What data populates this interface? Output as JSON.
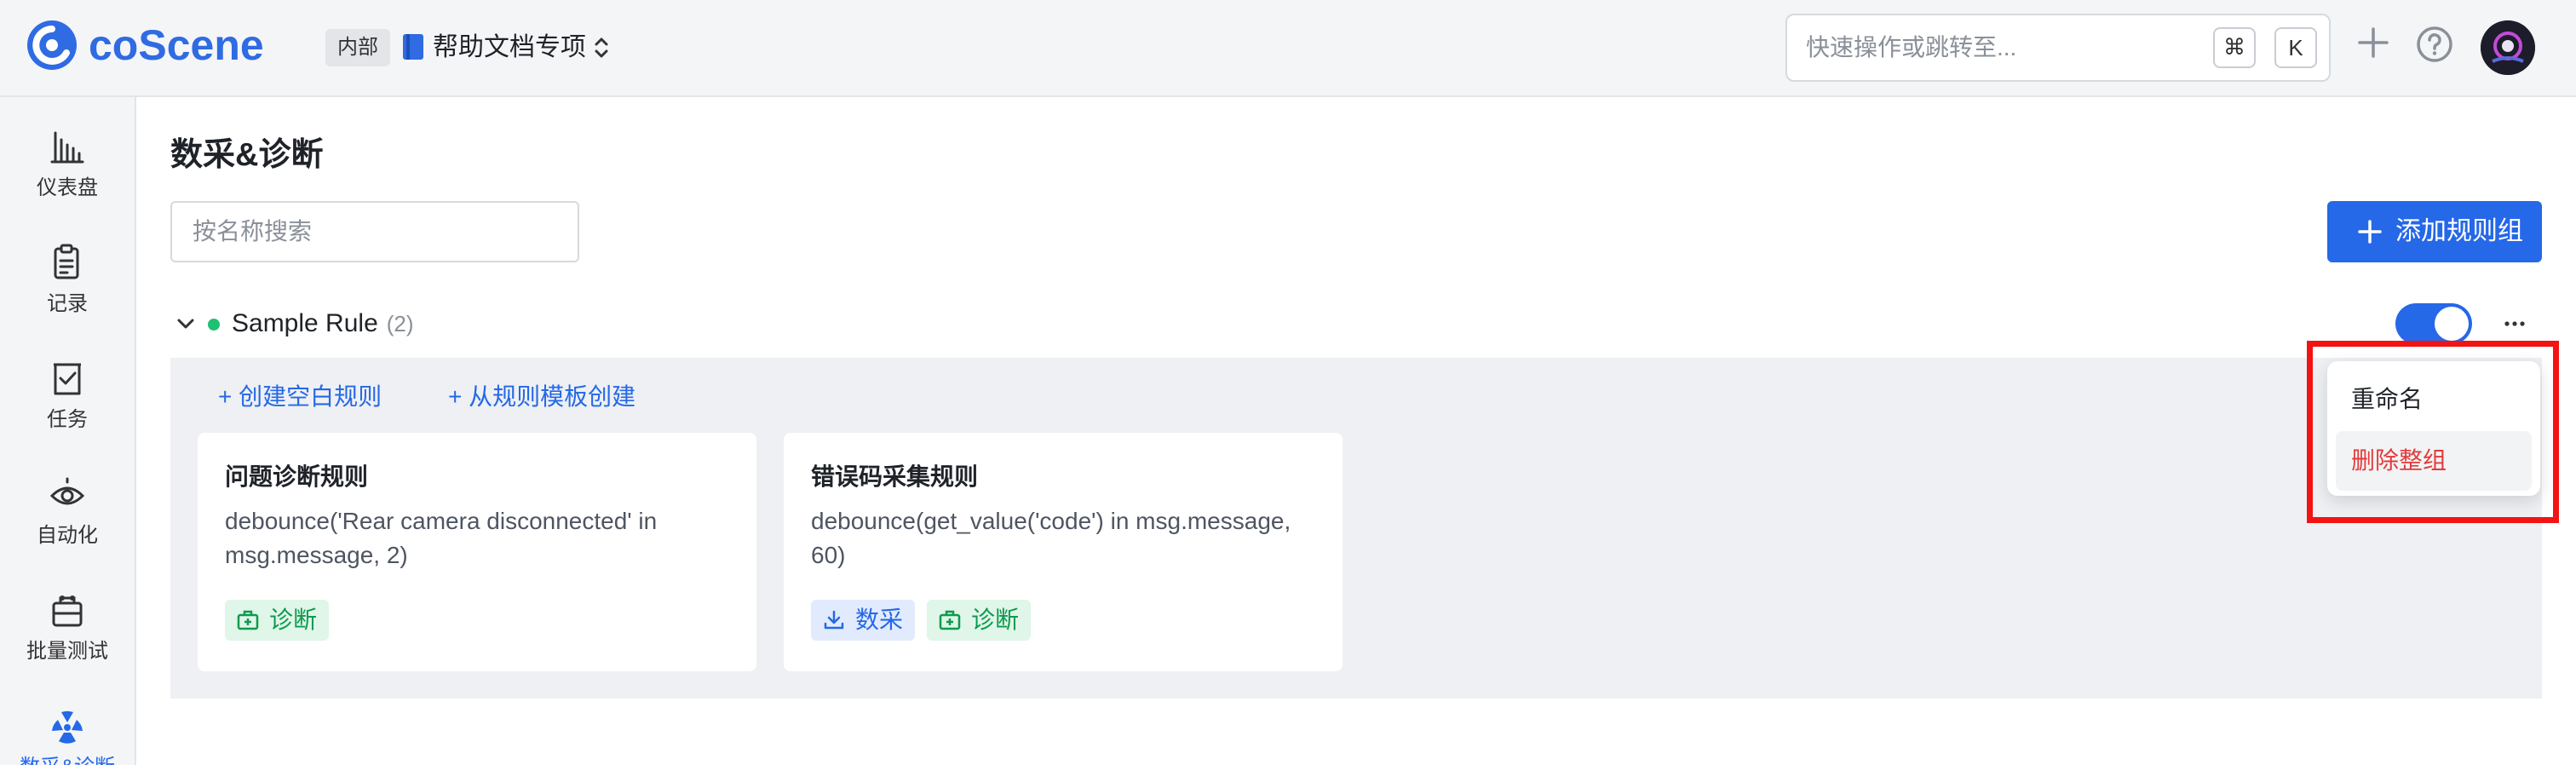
{
  "header": {
    "logo_text": "coScene",
    "workspace_badge": "内部",
    "workspace_name": "帮助文档专项",
    "search_placeholder": "快速操作或跳转至...",
    "search_shortcut_cmd": "⌘",
    "search_shortcut_key": "K",
    "icons": [
      "coscene-logo-icon",
      "book-icon",
      "chevron-updown-icon",
      "plus-icon",
      "help-icon",
      "avatar"
    ]
  },
  "sidebar": {
    "items": [
      {
        "label": "仪表盘",
        "icon": "bar-chart-icon"
      },
      {
        "label": "记录",
        "icon": "clipboard-icon"
      },
      {
        "label": "任务",
        "icon": "task-check-icon"
      },
      {
        "label": "自动化",
        "icon": "automation-icon"
      },
      {
        "label": "批量测试",
        "icon": "batch-test-icon"
      },
      {
        "label": "数采&诊断",
        "icon": "radiation-icon"
      }
    ]
  },
  "main": {
    "title": "数采&诊断",
    "search_placeholder": "按名称搜索",
    "add_group_label": "添加规则组",
    "group": {
      "name": "Sample Rule",
      "count": "(2)",
      "enabled": true,
      "create_blank_label": "创建空白规则",
      "create_from_template_label": "从规则模板创建",
      "rules": [
        {
          "title": "问题诊断规则",
          "expression": "debounce('Rear camera disconnected' in msg.message, 2)",
          "tags": [
            {
              "label": "诊断",
              "type": "diagnose"
            }
          ]
        },
        {
          "title": "错误码采集规则",
          "expression": "debounce(get_value('code') in msg.message, 60)",
          "tags": [
            {
              "label": "数采",
              "type": "collect"
            },
            {
              "label": "诊断",
              "type": "diagnose"
            }
          ]
        }
      ]
    }
  },
  "dropdown": {
    "rename_label": "重命名",
    "delete_label": "删除整组"
  },
  "colors": {
    "primary": "#2568e8",
    "status_dot": "#1fbf74",
    "danger": "#e23b3b",
    "highlight_box": "#f21313"
  }
}
